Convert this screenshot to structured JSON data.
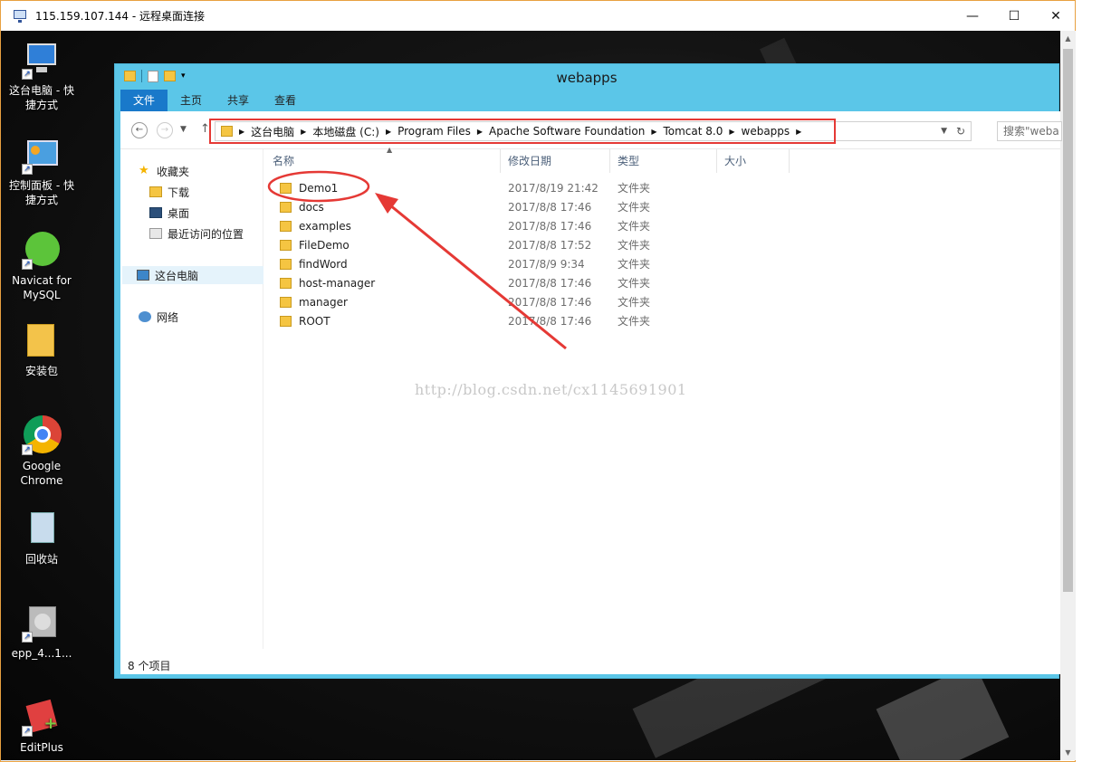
{
  "rdp_window": {
    "title": "115.159.107.144 - 远程桌面连接",
    "minimize_glyph": "—",
    "maximize_glyph": "☐",
    "close_glyph": "✕"
  },
  "desktop_icons": [
    {
      "label": "这台电脑 - 快捷方式",
      "icon": "computer-icon"
    },
    {
      "label": "控制面板 - 快捷方式",
      "icon": "control-panel-icon"
    },
    {
      "label": "Navicat for MySQL",
      "icon": "navicat-icon"
    },
    {
      "label": "安装包",
      "icon": "folder-icon"
    },
    {
      "label": "Google Chrome",
      "icon": "chrome-icon"
    },
    {
      "label": "回收站",
      "icon": "recycle-bin-icon"
    },
    {
      "label": "epp_4...1...",
      "icon": "installer-icon"
    },
    {
      "label": "EditPlus",
      "icon": "editplus-icon"
    }
  ],
  "explorer": {
    "title": "webapps",
    "ribbon_tabs": [
      "文件",
      "主页",
      "共享",
      "查看"
    ],
    "breadcrumb": [
      "这台电脑",
      "本地磁盘 (C:)",
      "Program Files",
      "Apache Software Foundation",
      "Tomcat 8.0",
      "webapps"
    ],
    "search_placeholder": "搜索\"weba",
    "sidebar": {
      "favorites": "收藏夹",
      "favorites_items": [
        "下载",
        "桌面",
        "最近访问的位置"
      ],
      "this_pc": "这台电脑",
      "network": "网络"
    },
    "columns": [
      "名称",
      "修改日期",
      "类型",
      "大小"
    ],
    "files": [
      {
        "name": "Demo1",
        "date": "2017/8/19 21:42",
        "type": "文件夹"
      },
      {
        "name": "docs",
        "date": "2017/8/8 17:46",
        "type": "文件夹"
      },
      {
        "name": "examples",
        "date": "2017/8/8 17:46",
        "type": "文件夹"
      },
      {
        "name": "FileDemo",
        "date": "2017/8/8 17:52",
        "type": "文件夹"
      },
      {
        "name": "findWord",
        "date": "2017/8/9 9:34",
        "type": "文件夹"
      },
      {
        "name": "host-manager",
        "date": "2017/8/8 17:46",
        "type": "文件夹"
      },
      {
        "name": "manager",
        "date": "2017/8/8 17:46",
        "type": "文件夹"
      },
      {
        "name": "ROOT",
        "date": "2017/8/8 17:46",
        "type": "文件夹"
      }
    ],
    "status": "8 个项目"
  },
  "watermark": "http://blog.csdn.net/cx1145691901",
  "colors": {
    "accent": "#1979ca",
    "title_bar": "#5bc6e8",
    "annotation": "#e53935"
  }
}
